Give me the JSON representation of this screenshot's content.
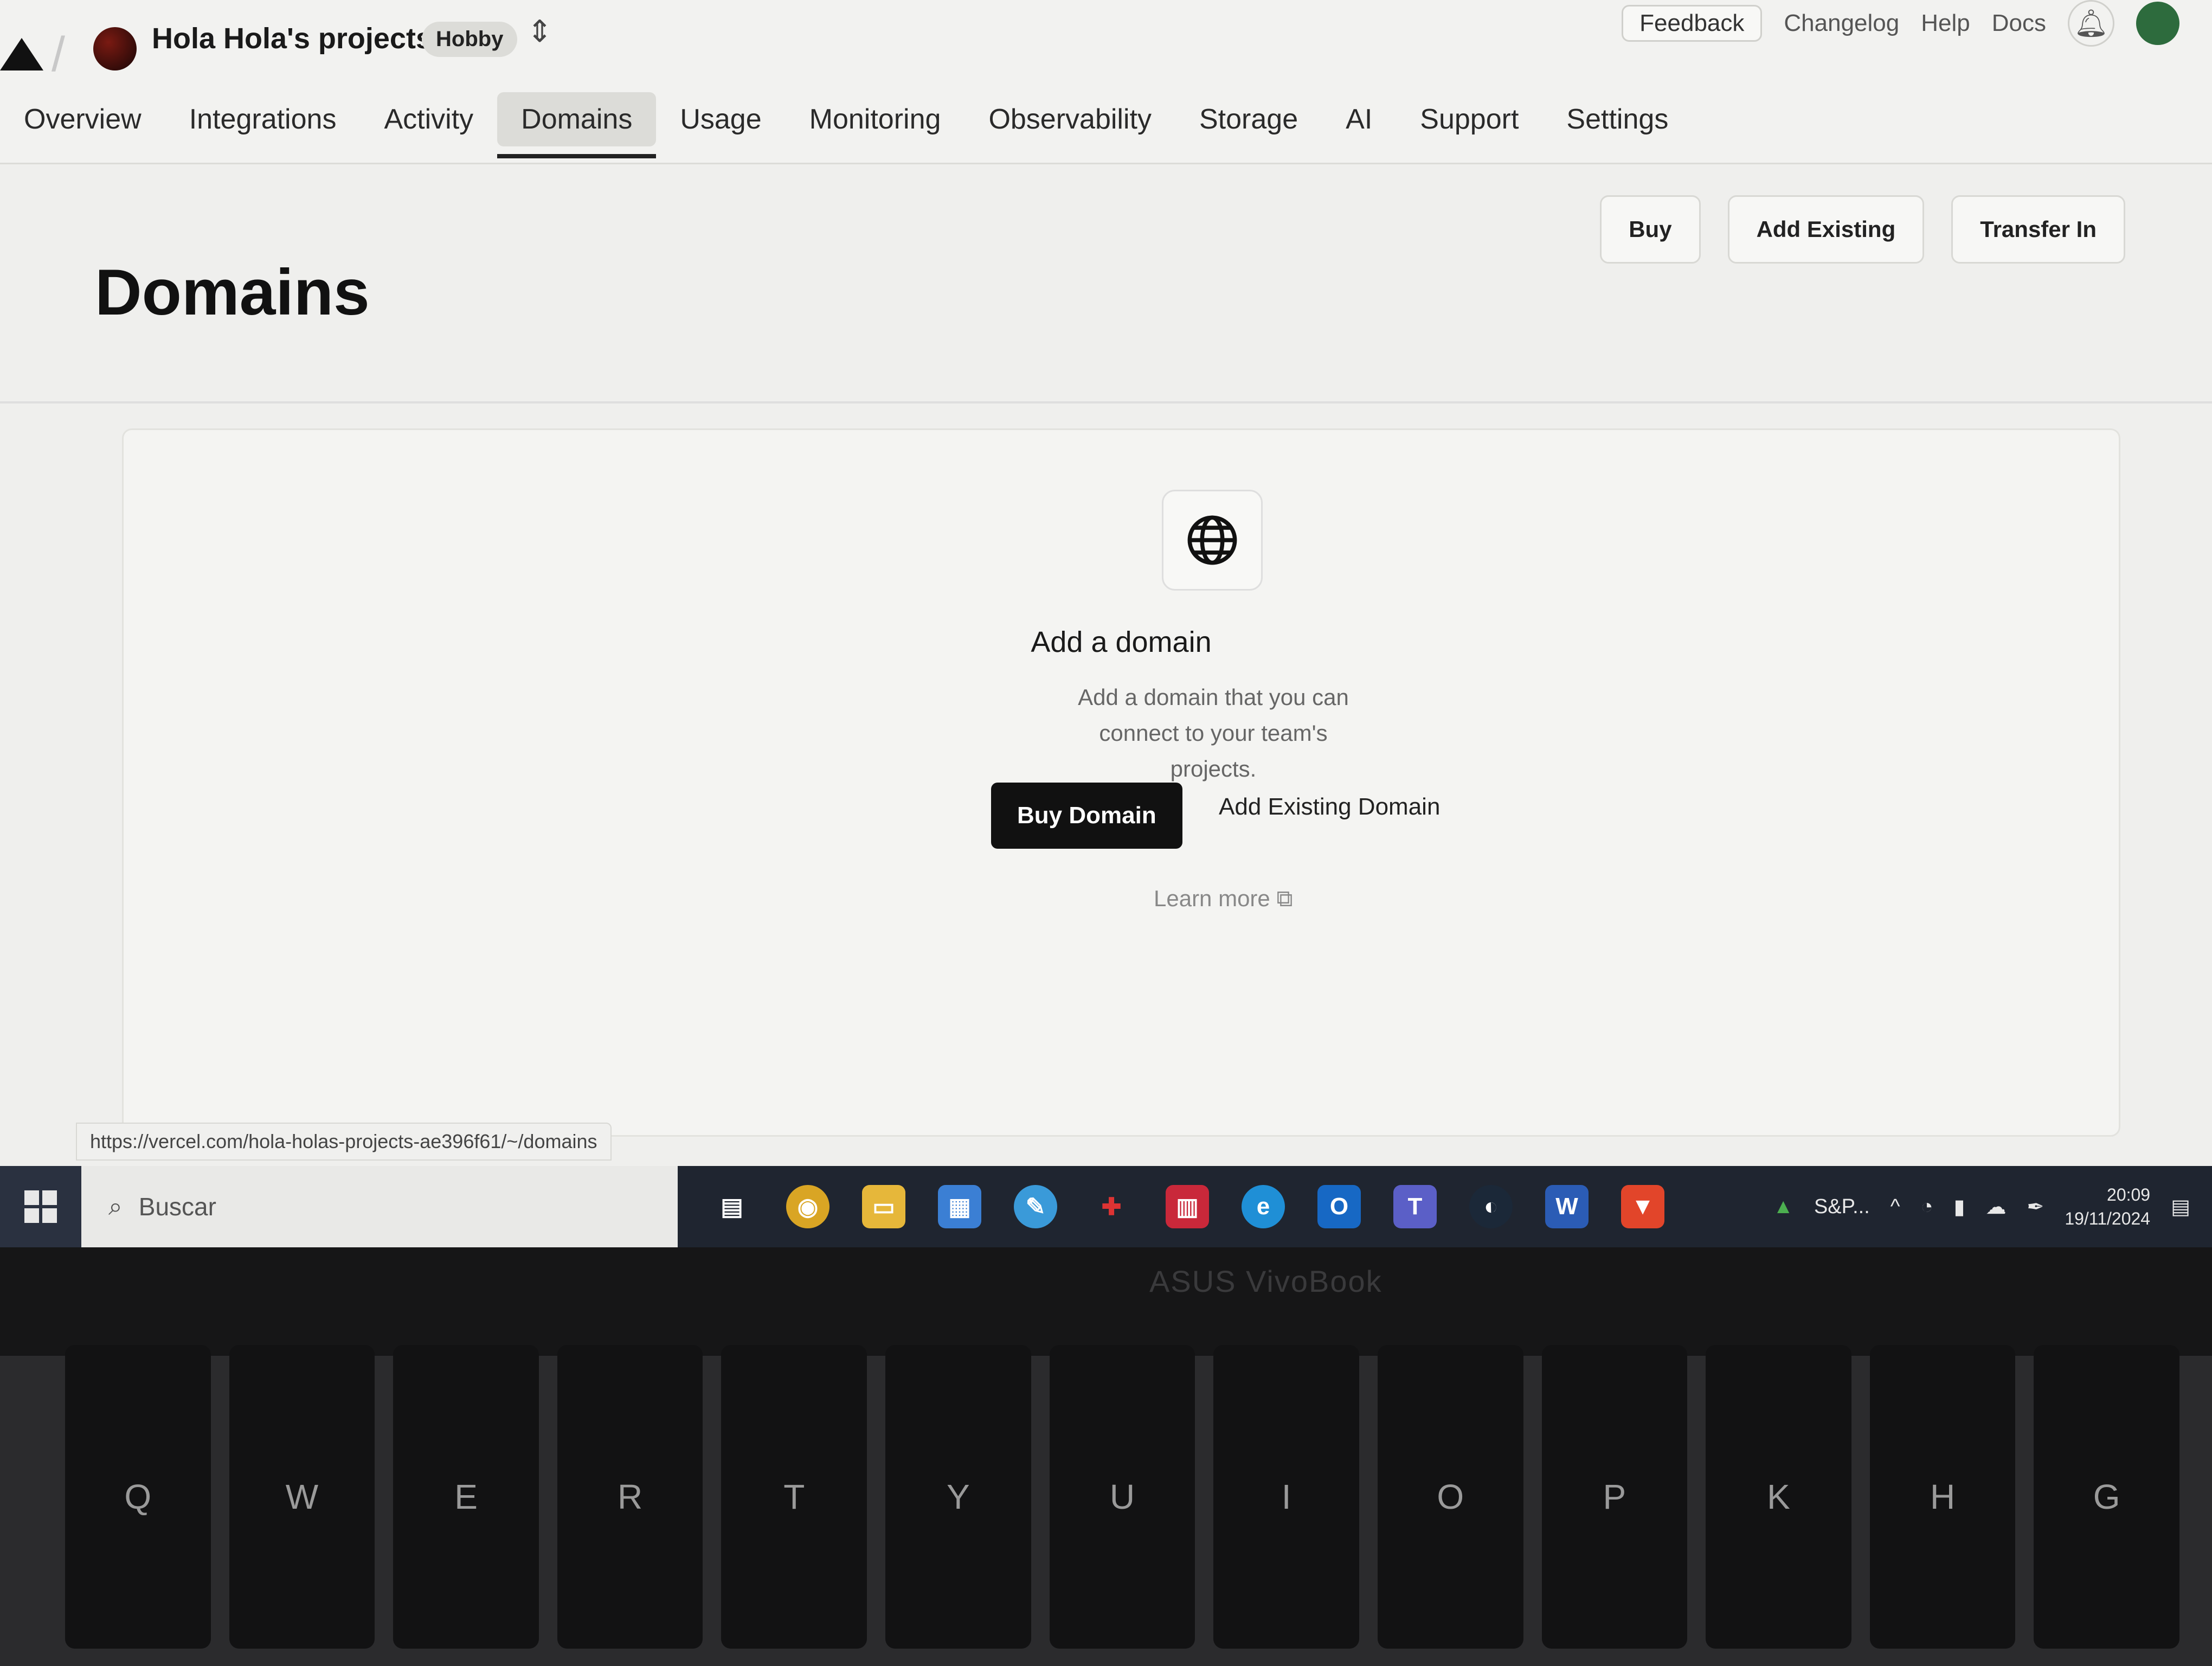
{
  "header": {
    "team_name": "Hola Hola's projects",
    "plan_badge": "Hobby",
    "feedback": "Feedback",
    "changelog": "Changelog",
    "help": "Help",
    "docs": "Docs"
  },
  "nav": {
    "tabs": [
      {
        "label": "Overview"
      },
      {
        "label": "Integrations"
      },
      {
        "label": "Activity"
      },
      {
        "label": "Domains",
        "active": true
      },
      {
        "label": "Usage"
      },
      {
        "label": "Monitoring"
      },
      {
        "label": "Observability"
      },
      {
        "label": "Storage"
      },
      {
        "label": "AI"
      },
      {
        "label": "Support"
      },
      {
        "label": "Settings"
      }
    ]
  },
  "page": {
    "title": "Domains",
    "actions": {
      "buy": "Buy",
      "add_existing": "Add Existing",
      "transfer_in": "Transfer In"
    }
  },
  "empty_state": {
    "icon": "globe-icon",
    "title": "Add a domain",
    "description": "Add a domain that you can connect to your team's projects.",
    "primary_button": "Buy Domain",
    "secondary_link": "Add Existing Domain",
    "learn_more": "Learn more"
  },
  "status_bar": {
    "url": "https://vercel.com/hola-holas-projects-ae396f61/~/domains"
  },
  "taskbar": {
    "search_placeholder": "Buscar",
    "tray_stock": "S&P...",
    "time": "20:09",
    "date": "19/11/2024"
  },
  "device": {
    "brand": "ASUS VivoBook"
  },
  "keyboard": {
    "keys": [
      "Q",
      "W",
      "E",
      "R",
      "T",
      "Y",
      "U",
      "I",
      "O",
      "P",
      "K",
      "H",
      "G"
    ]
  },
  "colors": {
    "primary_button": "#111111",
    "taskbar": "#1f2530"
  }
}
